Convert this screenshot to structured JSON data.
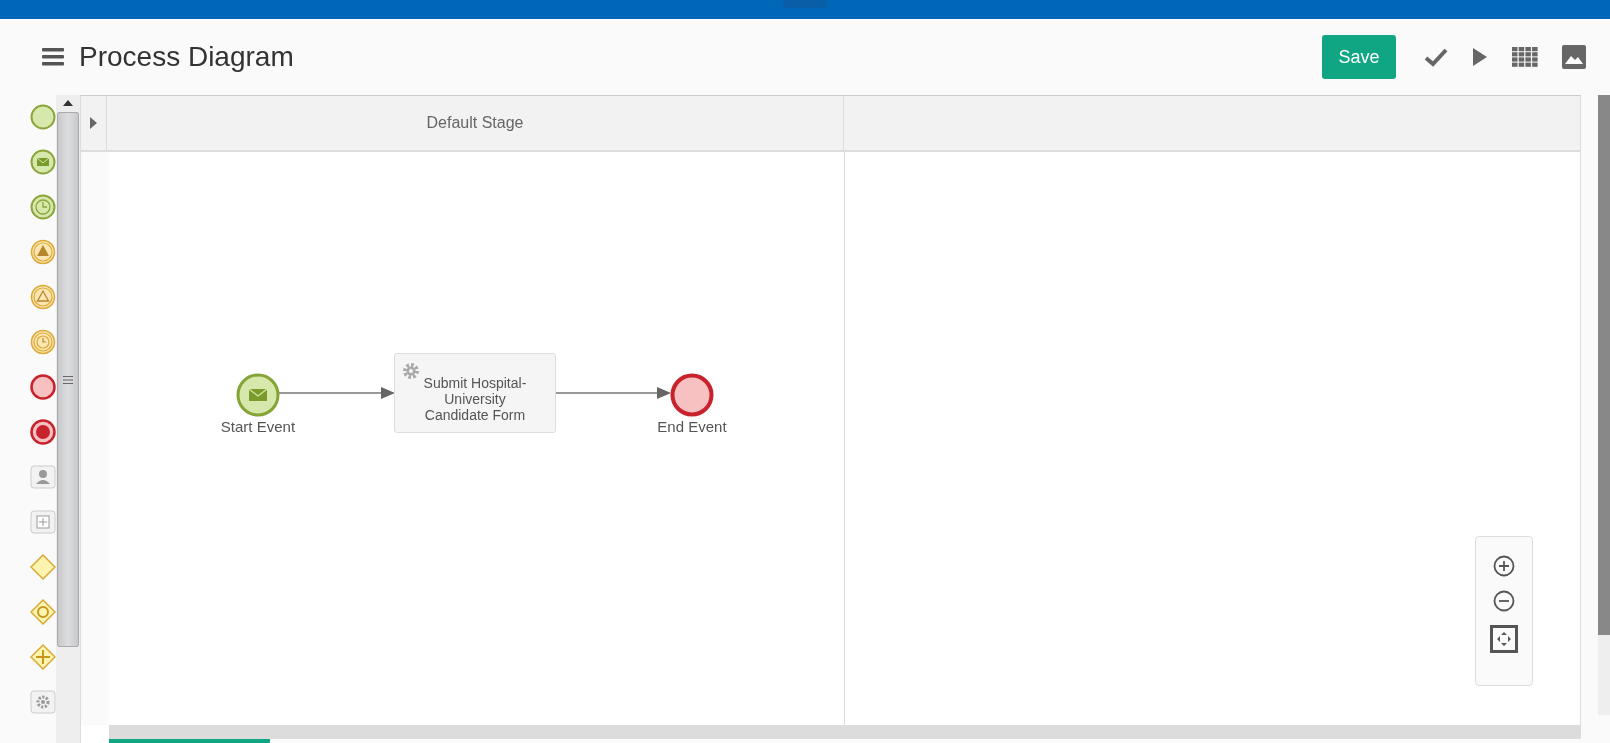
{
  "header": {
    "title": "Process Diagram",
    "save_label": "Save"
  },
  "palette": [
    {
      "kind": "start-none"
    },
    {
      "kind": "start-message"
    },
    {
      "kind": "start-timer"
    },
    {
      "kind": "signal-throw"
    },
    {
      "kind": "signal-catch"
    },
    {
      "kind": "intermediate-timer"
    },
    {
      "kind": "end-none"
    },
    {
      "kind": "end-terminate"
    },
    {
      "kind": "user-task"
    },
    {
      "kind": "subprocess"
    },
    {
      "kind": "gateway-exclusive"
    },
    {
      "kind": "gateway-inclusive"
    },
    {
      "kind": "gateway-parallel"
    },
    {
      "kind": "service-task"
    }
  ],
  "stages": [
    {
      "title": "Default Stage",
      "nodes": [
        {
          "kind": "start-message",
          "label": "Start Event"
        },
        {
          "kind": "service-task",
          "label": "Submit Hospital-University Candidate Form"
        },
        {
          "kind": "end-none",
          "label": "End Event"
        }
      ]
    }
  ]
}
